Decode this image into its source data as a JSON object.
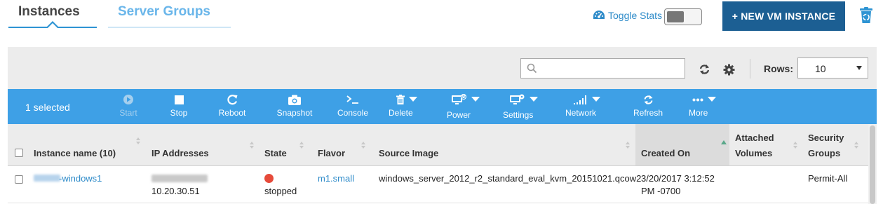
{
  "tabs": {
    "instances": "Instances",
    "server_groups": "Server Groups"
  },
  "header": {
    "toggle_stats": "Toggle Stats",
    "new_vm": "+ NEW VM INSTANCE"
  },
  "filter": {
    "search_placeholder": "",
    "rows_label": "Rows:",
    "rows_value": "10"
  },
  "toolbar": {
    "selected": "1 selected",
    "start": "Start",
    "stop": "Stop",
    "reboot": "Reboot",
    "snapshot": "Snapshot",
    "console": "Console",
    "delete": "Delete",
    "power": "Power",
    "settings": "Settings",
    "network": "Network",
    "refresh": "Refresh",
    "more": "More"
  },
  "table": {
    "columns": {
      "name": "Instance name (10)",
      "ip": "IP Addresses",
      "state": "State",
      "flavor": "Flavor",
      "source": "Source Image",
      "created": "Created On",
      "volumes_1": "Attached",
      "volumes_2": "Volumes",
      "security_1": "Security",
      "security_2": "Groups"
    },
    "rows": [
      {
        "name": "-windows1",
        "ip": "10.20.30.51",
        "state": "stopped",
        "flavor": "m1.small",
        "source": "windows_server_2012_r2_standard_eval_kvm_20151021.qcow2",
        "created_1": "3/20/2017 3:12:52",
        "created_2": "PM -0700",
        "volumes": "",
        "security": "Permit-All"
      }
    ]
  },
  "colors": {
    "toolbar": "#3ea0e6",
    "primary_button": "#1c5f93",
    "stopped": "#e64a3a",
    "link": "#2e8bc9"
  }
}
